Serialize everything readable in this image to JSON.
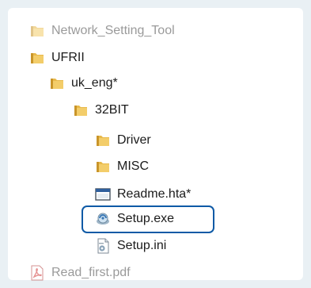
{
  "tree": {
    "items": [
      {
        "label": "Network_Setting_Tool",
        "icon": "folder-icon"
      },
      {
        "label": "UFRII",
        "icon": "folder-icon"
      },
      {
        "label": "uk_eng*",
        "icon": "folder-icon"
      },
      {
        "label": "32BIT",
        "icon": "folder-icon"
      },
      {
        "label": "Driver",
        "icon": "folder-icon"
      },
      {
        "label": "MISC",
        "icon": "folder-icon"
      },
      {
        "label": "Readme.hta*",
        "icon": "hta-file-icon"
      },
      {
        "label": "Setup.exe",
        "icon": "setup-exe-icon"
      },
      {
        "label": "Setup.ini",
        "icon": "ini-settings-file-icon"
      },
      {
        "label": "Read_first.pdf",
        "icon": "pdf-file-icon"
      }
    ],
    "highlighted": "Setup.exe"
  },
  "colors": {
    "background": "#e9f0f4",
    "folder": "#e8b94a",
    "highlight_border": "#0e5aa6",
    "dim_text": "#9a9a9a"
  }
}
